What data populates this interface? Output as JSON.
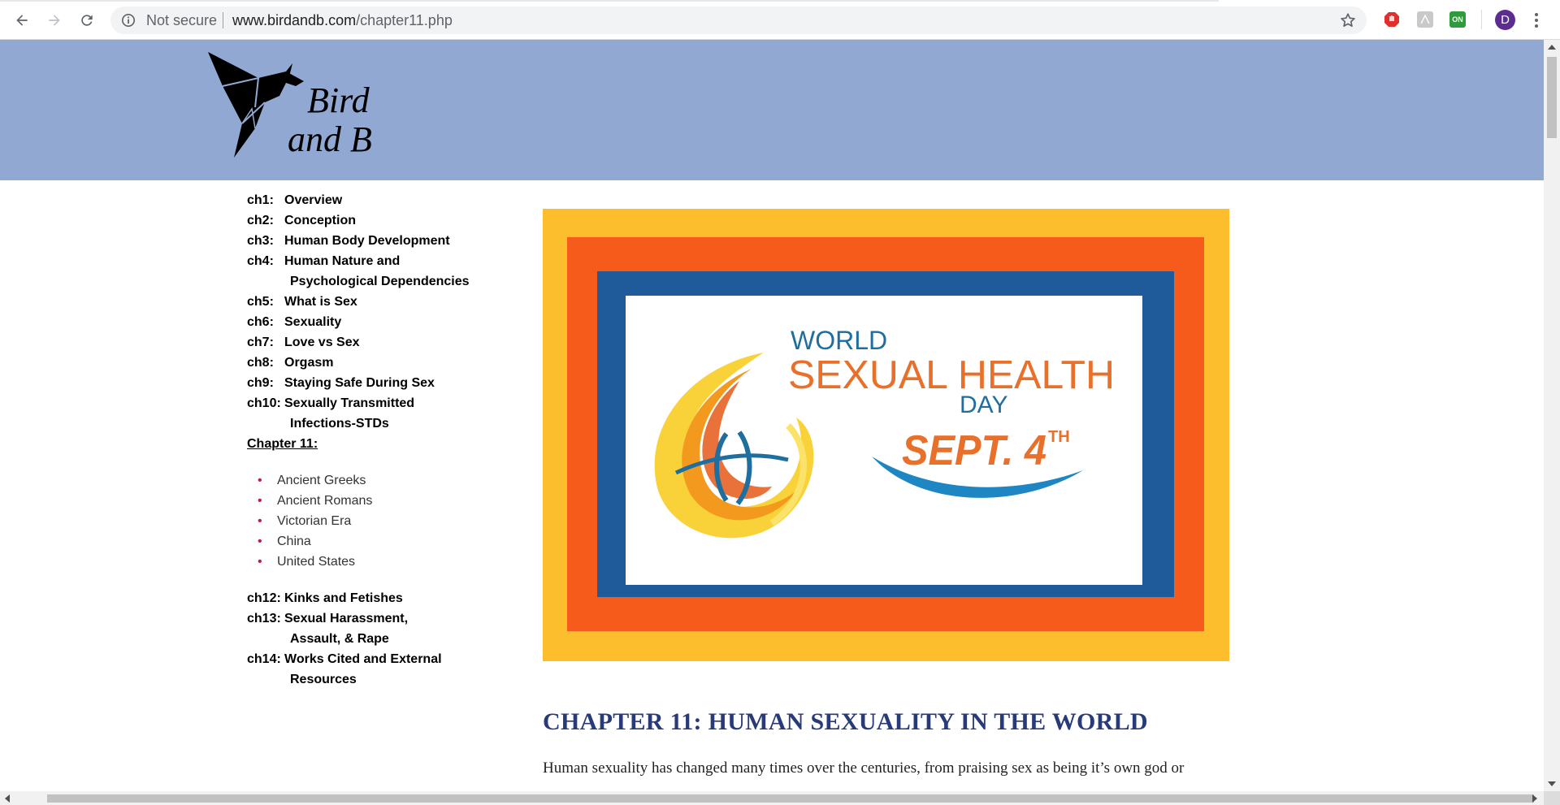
{
  "browser": {
    "security_label": "Not secure",
    "url_host": "www.birdandb.com",
    "url_path": "/chapter11.php",
    "extensions": [
      {
        "name": "adblock-icon",
        "color": "#e0302b"
      },
      {
        "name": "pdf-icon",
        "color": "#c9c9c9"
      },
      {
        "name": "on-icon",
        "color": "#2e9c3a",
        "label": "ON"
      }
    ],
    "profile_initial": "D",
    "profile_color": "#5c2d91"
  },
  "header": {
    "logo_line1": "Bird",
    "logo_line2": "and B",
    "background": "#91a8d3"
  },
  "sidebar": {
    "chapters_before": [
      {
        "num": "ch1:",
        "title": "Overview"
      },
      {
        "num": "ch2:",
        "title": "Conception"
      },
      {
        "num": "ch3:",
        "title": "Human Body Development"
      },
      {
        "num": "ch4:",
        "title": "Human Nature and",
        "cont": "Psychological Dependencies"
      },
      {
        "num": "ch5:",
        "title": "What is Sex"
      },
      {
        "num": "ch6:",
        "title": "Sexuality"
      },
      {
        "num": "ch7:",
        "title": "Love vs Sex"
      },
      {
        "num": "ch8:",
        "title": "Orgasm"
      },
      {
        "num": "ch9:",
        "title": "Staying Safe During Sex"
      },
      {
        "num": "ch10:",
        "title": "Sexually Transmitted",
        "cont": "Infections-STDs"
      }
    ],
    "current_chapter": "Chapter 11:",
    "sections": [
      "Ancient Greeks",
      "Ancient Romans",
      "Victorian Era",
      "China",
      "United States"
    ],
    "chapters_after": [
      {
        "num": "ch12:",
        "title": "Kinks and Fetishes"
      },
      {
        "num": "ch13:",
        "title": "Sexual Harassment,",
        "cont": "Assault, & Rape"
      },
      {
        "num": "ch14:",
        "title": "Works Cited and External",
        "cont": "Resources"
      }
    ]
  },
  "banner": {
    "line1": "WORLD",
    "line2": "SEXUAL HEALTH",
    "line3": "DAY",
    "date": "SEPT. 4",
    "date_sup": "TH",
    "colors": {
      "outer": "#fdbe2d",
      "middle": "#f75b1c",
      "inner": "#1f5a9b",
      "text_blue": "#1f6ea0",
      "text_orange": "#e8702a"
    }
  },
  "main": {
    "title": "CHAPTER 11: HUMAN SEXUALITY IN THE WORLD",
    "intro": "Human sexuality has changed many times over the centuries, from praising sex as being it’s own god or"
  }
}
